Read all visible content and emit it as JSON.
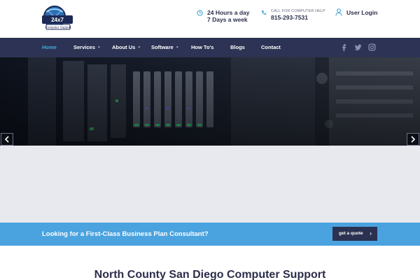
{
  "header": {
    "logo_text": "24 x 7 TECHS",
    "logo_tagline": "Computer Support",
    "hours_line1": "24 Hours a day",
    "hours_line2": "7 Days a week",
    "phone_label": "CALL FOR COMPUTER HELP",
    "phone_number": "815-293-7531",
    "login_label": "User Login"
  },
  "nav": {
    "items": [
      {
        "label": "Home",
        "active": true
      },
      {
        "label": "Services",
        "dropdown": true
      },
      {
        "label": "About Us",
        "dropdown": true
      },
      {
        "label": "Software",
        "dropdown": true
      },
      {
        "label": "How To's"
      },
      {
        "label": "Blogs"
      },
      {
        "label": "Contact"
      }
    ],
    "social": [
      "facebook-icon",
      "twitter-icon",
      "instagram-icon"
    ]
  },
  "banner": {
    "text": "Looking for a First-Class Business Plan Consultant?",
    "button_label": "get a quote"
  },
  "main": {
    "heading": "North County San Diego Computer Support"
  },
  "colors": {
    "nav_bg": "#2d3354",
    "accent": "#43a7d9",
    "banner_bg": "#4aa3df",
    "button_bg": "#2b3150"
  }
}
